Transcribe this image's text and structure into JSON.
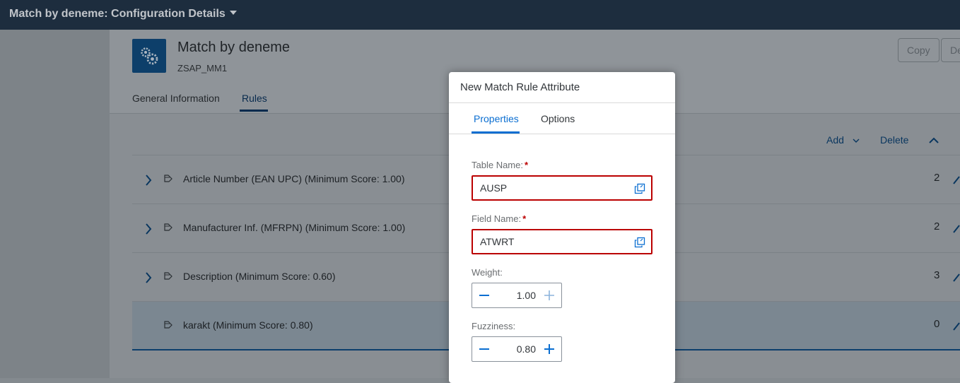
{
  "shell": {
    "title": "Match by deneme: Configuration Details"
  },
  "header": {
    "title": "Match by deneme",
    "subtitle": "ZSAP_MM1",
    "actions": {
      "copy": "Copy",
      "delete_partial": "De"
    },
    "tabs": [
      {
        "label": "General Information"
      },
      {
        "label": "Rules"
      }
    ],
    "active_tab": "Rules"
  },
  "toolbar": {
    "add": "Add",
    "delete": "Delete"
  },
  "rules": [
    {
      "label": "Article Number (EAN UPC) (Minimum Score: 1.00)",
      "count": "2",
      "expandable": true
    },
    {
      "label": "Manufacturer Inf. (MFRPN) (Minimum Score: 1.00)",
      "count": "2",
      "expandable": true
    },
    {
      "label": "Description (Minimum Score: 0.60)",
      "count": "3",
      "expandable": true
    },
    {
      "label": "karakt (Minimum Score: 0.80)",
      "count": "0",
      "expandable": false,
      "selected": true
    }
  ],
  "dialog": {
    "title": "New Match Rule Attribute",
    "tabs": [
      {
        "label": "Properties"
      },
      {
        "label": "Options"
      }
    ],
    "active_tab": "Properties",
    "table_name": {
      "label": "Table Name:",
      "value": "AUSP",
      "required": true
    },
    "field_name": {
      "label": "Field Name:",
      "value": "ATWRT",
      "required": true
    },
    "weight": {
      "label": "Weight:",
      "value": "1.00"
    },
    "fuzziness": {
      "label": "Fuzziness:",
      "value": "0.80"
    }
  },
  "colors": {
    "accent": "#0a6ed1",
    "error": "#bb0000",
    "shell": "#1d2d3e"
  }
}
